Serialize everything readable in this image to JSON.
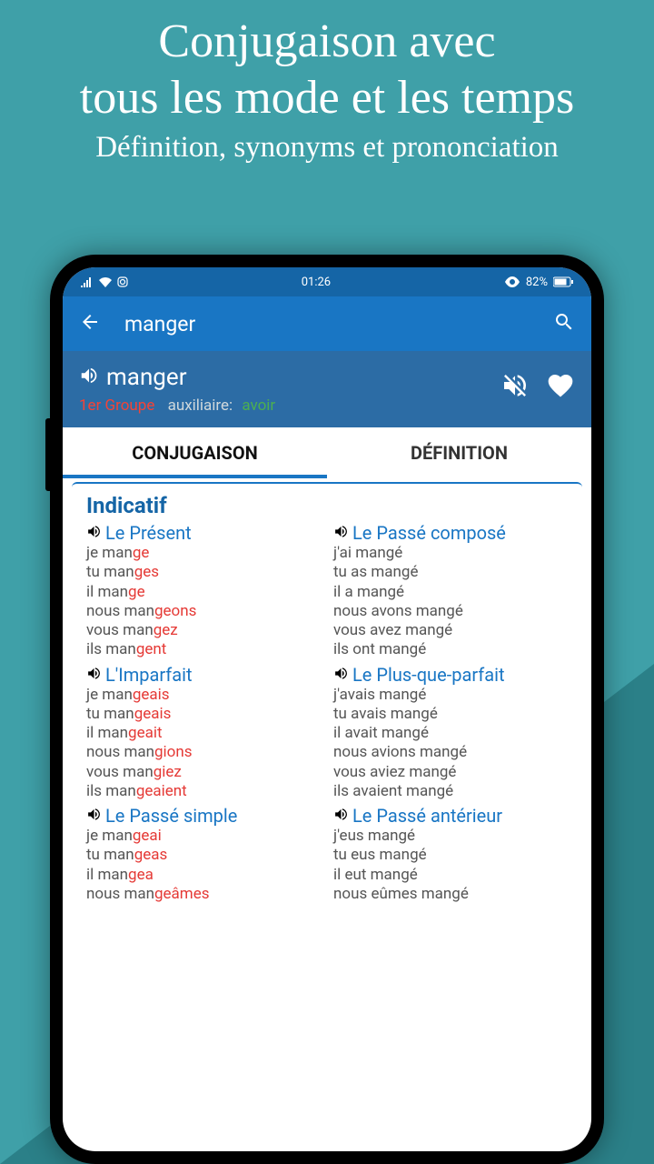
{
  "promo": {
    "title_line1": "Conjugaison avec",
    "title_line2": "tous les mode et les temps",
    "subtitle": "Définition, synonyms et prononciation"
  },
  "status": {
    "time": "01:26",
    "battery": "82%"
  },
  "appbar": {
    "title": "manger"
  },
  "word": {
    "title": "manger",
    "group": "1er Groupe",
    "aux_label": "auxiliaire:",
    "aux_value": "avoir"
  },
  "tabs": {
    "conjugation": "CONJUGAISON",
    "definition": "DÉFINITION"
  },
  "mood": "Indicatif",
  "tenses": [
    {
      "title": "Le Présent",
      "forms": [
        {
          "pre": "je man",
          "end": "ge"
        },
        {
          "pre": "tu man",
          "end": "ges"
        },
        {
          "pre": "il man",
          "end": "ge"
        },
        {
          "pre": "nous man",
          "end": "geons"
        },
        {
          "pre": "vous man",
          "end": "gez"
        },
        {
          "pre": "ils man",
          "end": "gent"
        }
      ]
    },
    {
      "title": "Le Passé composé",
      "forms": [
        {
          "pre": "j'ai mangé",
          "end": ""
        },
        {
          "pre": "tu as mangé",
          "end": ""
        },
        {
          "pre": "il a mangé",
          "end": ""
        },
        {
          "pre": "nous avons mangé",
          "end": ""
        },
        {
          "pre": "vous avez mangé",
          "end": ""
        },
        {
          "pre": "ils ont mangé",
          "end": ""
        }
      ]
    },
    {
      "title": "L'Imparfait",
      "forms": [
        {
          "pre": "je man",
          "end": "geais"
        },
        {
          "pre": "tu man",
          "end": "geais"
        },
        {
          "pre": "il man",
          "end": "geait"
        },
        {
          "pre": "nous man",
          "end": "gions"
        },
        {
          "pre": "vous man",
          "end": "giez"
        },
        {
          "pre": "ils man",
          "end": "geaient"
        }
      ]
    },
    {
      "title": "Le Plus-que-parfait",
      "forms": [
        {
          "pre": "j'avais mangé",
          "end": ""
        },
        {
          "pre": "tu avais mangé",
          "end": ""
        },
        {
          "pre": "il avait mangé",
          "end": ""
        },
        {
          "pre": "nous avions mangé",
          "end": ""
        },
        {
          "pre": "vous aviez mangé",
          "end": ""
        },
        {
          "pre": "ils avaient mangé",
          "end": ""
        }
      ]
    },
    {
      "title": "Le Passé simple",
      "forms": [
        {
          "pre": "je man",
          "end": "geai"
        },
        {
          "pre": "tu man",
          "end": "geas"
        },
        {
          "pre": "il man",
          "end": "gea"
        },
        {
          "pre": "nous man",
          "end": "geâmes"
        }
      ]
    },
    {
      "title": "Le Passé antérieur",
      "forms": [
        {
          "pre": "j'eus mangé",
          "end": ""
        },
        {
          "pre": "tu eus mangé",
          "end": ""
        },
        {
          "pre": "il eut mangé",
          "end": ""
        },
        {
          "pre": "nous eûmes mangé",
          "end": ""
        }
      ]
    }
  ]
}
